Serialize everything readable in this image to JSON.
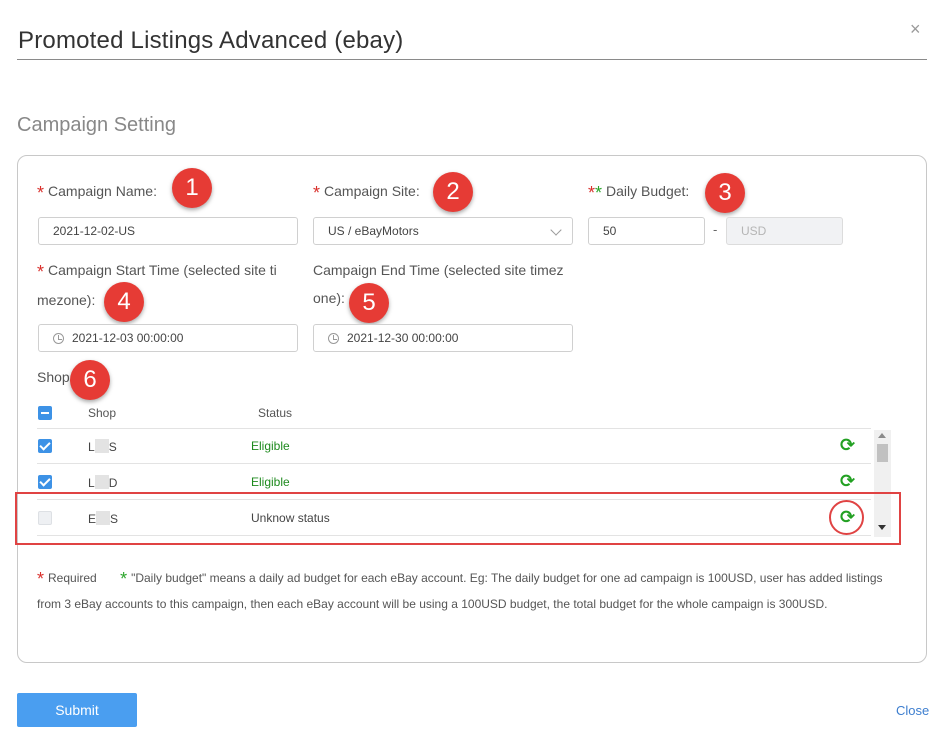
{
  "dialog": {
    "title": "Promoted Listings Advanced (ebay)",
    "close_icon": "×",
    "section_title": "Campaign Setting"
  },
  "form": {
    "campaign_name": {
      "required_mark": "*",
      "label": "Campaign Name:",
      "value": "2021-12-02-US"
    },
    "campaign_site": {
      "required_mark": "*",
      "label": "Campaign Site:",
      "value": "US / eBayMotors"
    },
    "daily_budget": {
      "required_mark": "*",
      "special_mark": "*",
      "label": "Daily Budget:",
      "value": "50",
      "separator": "-",
      "currency": "USD"
    },
    "start_time": {
      "required_mark": "*",
      "label_line1": "Campaign Start Time (selected site ti",
      "label_line2": "mezone):",
      "value": "2021-12-03 00:00:00"
    },
    "end_time": {
      "label_line1": "Campaign End Time (selected site timez",
      "label_line2": "one):",
      "value": "2021-12-30 00:00:00"
    },
    "shop_label": "Shop"
  },
  "badges": [
    "1",
    "2",
    "3",
    "4",
    "5",
    "6"
  ],
  "shop_table": {
    "headers": {
      "shop": "Shop",
      "status": "Status"
    },
    "rows": [
      {
        "shop_prefix": "L",
        "shop_suffix": "S",
        "status": "Eligible",
        "checked": true
      },
      {
        "shop_prefix": "L",
        "shop_suffix": "D",
        "status": "Eligible",
        "checked": true
      },
      {
        "shop_prefix": "E",
        "shop_suffix": "S",
        "status": "Unknow status",
        "checked": false
      }
    ],
    "refresh_icon": "⟳"
  },
  "note": {
    "required_mark": "*",
    "required_text": "Required",
    "budget_mark": "*",
    "budget_text": "\"Daily budget\" means a daily ad budget for each eBay account. Eg: The daily budget for one ad campaign is 100USD, user has added listings from 3 eBay accounts to this campaign, then each eBay account will be using a 100USD budget, the total budget for the whole campaign is 300USD."
  },
  "footer": {
    "submit_label": "Submit",
    "close_label": "Close"
  },
  "colors": {
    "accent": "#4a9ef0",
    "required": "#d9302c",
    "eligible": "#1e8a1e",
    "badge": "#e63b35",
    "highlight": "#e04343"
  }
}
